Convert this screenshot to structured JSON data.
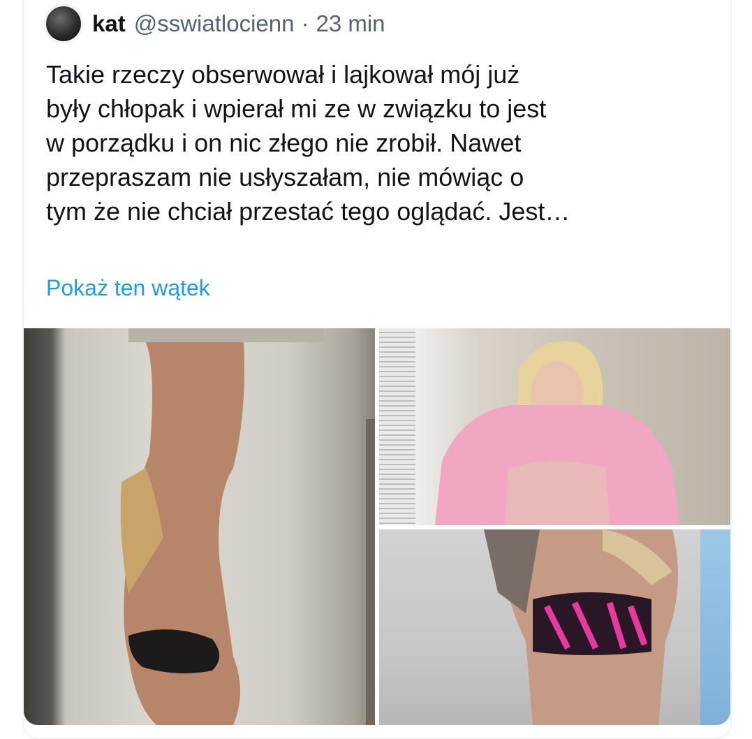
{
  "tweet": {
    "display_name": "kat",
    "handle": "@sswiatlocienn",
    "separator": "·",
    "time": "23 min",
    "text_lines": [
      "Takie rzeczy obserwował i lajkował mój już",
      "były chłopak i wpierał mi ze w związku to jest",
      "w porządku i on nic złego nie zrobił. Nawet",
      "przepraszam nie usłyszałam, nie mówiąc o",
      "tym że nie chciał przestać tego oglądać. Jest…"
    ],
    "show_thread": "Pokaż ten wątek",
    "link_color": "#1d9bf0"
  }
}
